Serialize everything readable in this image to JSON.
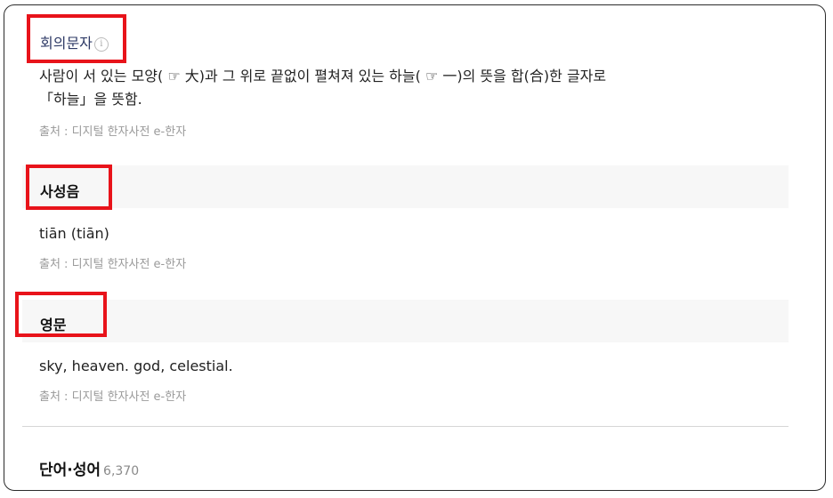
{
  "composition": {
    "title": "회의문자",
    "line1": "사람이 서 있는 모양( ☞ 大)과 그 위로 끝없이 펼쳐져 있는 하늘( ☞ 一)의 뜻을 합(合)한 글자로",
    "line2": "「하늘」을 뜻함.",
    "source": "출처 : 디지털 한자사전 e-한자"
  },
  "four_tones": {
    "title": "사성음",
    "value": "tiān (tiān)",
    "source": "출처 : 디지털 한자사전 e-한자"
  },
  "english": {
    "title": "영문",
    "value": "sky, heaven. god, celestial.",
    "source": "출처 : 디지털 한자사전 e-한자"
  },
  "words": {
    "title": "단어·성어",
    "count": "6,370"
  },
  "icons": {
    "info": "i"
  },
  "colors": {
    "highlight_box": "#e8131a",
    "header_band": "#f7f7f7",
    "link_title": "#2e3a66",
    "source_text": "#9a9a9a"
  }
}
